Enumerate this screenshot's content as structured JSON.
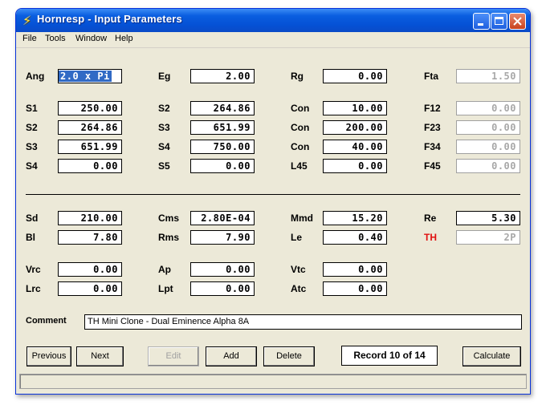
{
  "window": {
    "title": "Hornresp - Input Parameters"
  },
  "menu": {
    "file": "File",
    "tools": "Tools",
    "window": "Window",
    "help": "Help"
  },
  "params": {
    "ang": {
      "label": "Ang",
      "value": "2.0 x Pi"
    },
    "eg": {
      "label": "Eg",
      "value": "2.00"
    },
    "rg": {
      "label": "Rg",
      "value": "0.00"
    },
    "fta": {
      "label": "Fta",
      "value": "1.50"
    },
    "s1": {
      "label": "S1",
      "value": "250.00"
    },
    "s2a": {
      "label": "S2",
      "value": "264.86"
    },
    "con1": {
      "label": "Con",
      "value": "10.00"
    },
    "f12": {
      "label": "F12",
      "value": "0.00"
    },
    "s2b": {
      "label": "S2",
      "value": "264.86"
    },
    "s3a": {
      "label": "S3",
      "value": "651.99"
    },
    "con2": {
      "label": "Con",
      "value": "200.00"
    },
    "f23": {
      "label": "F23",
      "value": "0.00"
    },
    "s3b": {
      "label": "S3",
      "value": "651.99"
    },
    "s4a": {
      "label": "S4",
      "value": "750.00"
    },
    "con3": {
      "label": "Con",
      "value": "40.00"
    },
    "f34": {
      "label": "F34",
      "value": "0.00"
    },
    "s4b": {
      "label": "S4",
      "value": "0.00"
    },
    "s5": {
      "label": "S5",
      "value": "0.00"
    },
    "l45": {
      "label": "L45",
      "value": "0.00"
    },
    "f45": {
      "label": "F45",
      "value": "0.00"
    },
    "sd": {
      "label": "Sd",
      "value": "210.00"
    },
    "cms": {
      "label": "Cms",
      "value": "2.80E-04"
    },
    "mmd": {
      "label": "Mmd",
      "value": "15.20"
    },
    "re": {
      "label": "Re",
      "value": "5.30"
    },
    "bl": {
      "label": "Bl",
      "value": "7.80"
    },
    "rms": {
      "label": "Rms",
      "value": "7.90"
    },
    "le": {
      "label": "Le",
      "value": "0.40"
    },
    "th": {
      "label": "TH",
      "value": "2P"
    },
    "vrc": {
      "label": "Vrc",
      "value": "0.00"
    },
    "ap": {
      "label": "Ap",
      "value": "0.00"
    },
    "vtc": {
      "label": "Vtc",
      "value": "0.00"
    },
    "lrc": {
      "label": "Lrc",
      "value": "0.00"
    },
    "lpt": {
      "label": "Lpt",
      "value": "0.00"
    },
    "atc": {
      "label": "Atc",
      "value": "0.00"
    }
  },
  "comment": {
    "label": "Comment",
    "value": "TH Mini Clone - Dual Eminence Alpha 8A"
  },
  "buttons": {
    "previous": "Previous",
    "next": "Next",
    "edit": "Edit",
    "add": "Add",
    "delete": "Delete",
    "calculate": "Calculate"
  },
  "record": "Record 10 of 14",
  "colors": {
    "titlebar": "#0551d5",
    "th_label": "#e01010",
    "selection": "#316ac5"
  }
}
